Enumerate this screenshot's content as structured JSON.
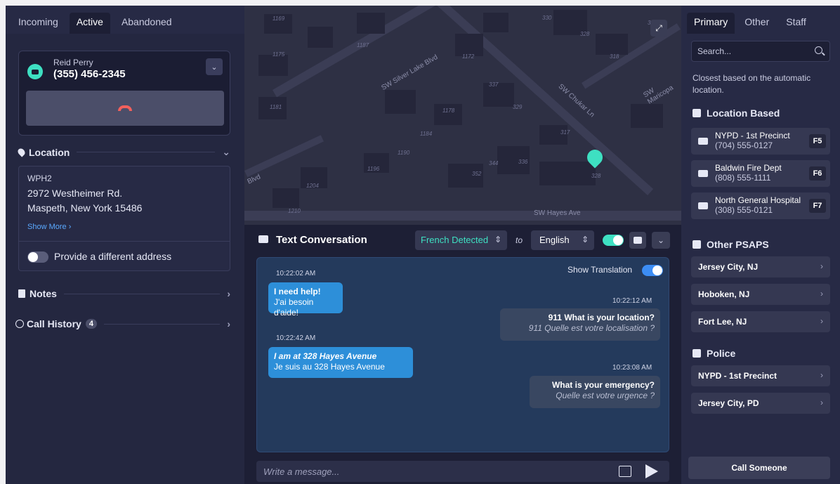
{
  "left": {
    "tabs": [
      "Incoming",
      "Active",
      "Abandoned"
    ],
    "caller": {
      "name": "Reid Perry",
      "phone": "(355) 456-2345"
    },
    "location": {
      "header": "Location",
      "code": "WPH2",
      "line1": "2972 Westheimer Rd.",
      "line2": "Maspeth, New York 15486",
      "show_more": "Show More",
      "different_address": "Provide a different address"
    },
    "notes_header": "Notes",
    "call_history": {
      "label": "Call History",
      "count": "4"
    }
  },
  "map": {
    "streets": [
      "SW Silver Lake Blvd",
      "SW Chukar Ln",
      "SW Maricopa",
      "SW Hayes Ave",
      "Blvd"
    ],
    "house_numbers": [
      "1169",
      "1175",
      "1181",
      "1187",
      "1172",
      "1178",
      "1184",
      "1190",
      "1196",
      "1204",
      "1210",
      "330",
      "328",
      "318",
      "310",
      "337",
      "329",
      "317",
      "344",
      "336",
      "352",
      "328"
    ]
  },
  "conversation": {
    "title": "Text Conversation",
    "detected_language": "French Detected",
    "to_word": "to",
    "target_language": "English",
    "show_translation": "Show Translation",
    "messages": [
      {
        "time": "10:22:02 AM",
        "original": "I need help!",
        "translation": "J'ai besoin d'aide!"
      },
      {
        "time": "10:22:12 AM",
        "original": "911 What is your location?",
        "translation": "911 Quelle est votre localisation ?"
      },
      {
        "time": "10:22:42 AM",
        "original": "I am at 328 Hayes Avenue",
        "translation": "Je suis au 328 Hayes Avenue"
      },
      {
        "time": "10:23:08 AM",
        "original": "What is your emergency?",
        "translation": "Quelle est votre urgence ?"
      }
    ],
    "composer_placeholder": "Write a message..."
  },
  "right": {
    "tabs": [
      "Primary",
      "Other",
      "Staff"
    ],
    "search_placeholder": "Search...",
    "closest_note": "Closest based on the automatic location.",
    "location_based_header": "Location Based",
    "location_based": [
      {
        "name": "NYPD - 1st Precinct",
        "phone": "(704) 555-0127",
        "key": "F5"
      },
      {
        "name": "Baldwin Fire Dept",
        "phone": "(808) 555-1111",
        "key": "F6"
      },
      {
        "name": "North General Hospital",
        "phone": "(308) 555-0121",
        "key": "F7"
      }
    ],
    "other_psaps_header": "Other PSAPS",
    "other_psaps": [
      "Jersey City, NJ",
      "Hoboken, NJ",
      "Fort Lee, NJ"
    ],
    "police_header": "Police",
    "police": [
      "NYPD - 1st Precinct",
      "Jersey City, PD"
    ],
    "call_button": "Call Someone"
  },
  "colors": {
    "accent_teal": "#3ee0c2",
    "accent_blue": "#3c8df4",
    "hangup_red": "#f2605c"
  }
}
